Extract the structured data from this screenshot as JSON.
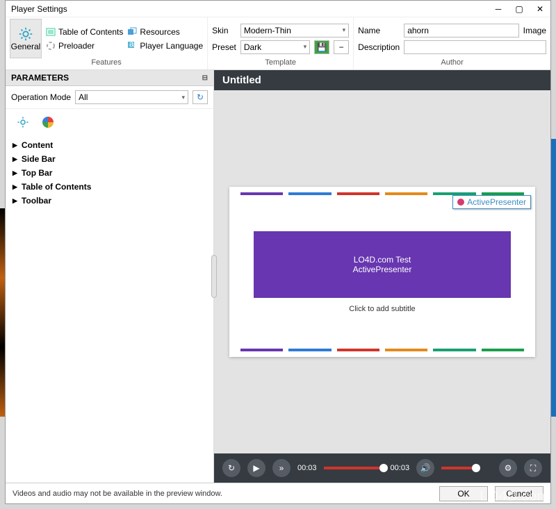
{
  "window": {
    "title": "Player Settings"
  },
  "ribbon": {
    "general": {
      "label": "General"
    },
    "features": {
      "label": "Features",
      "toc": "Table of Contents",
      "preloader": "Preloader",
      "resources": "Resources",
      "player_lang": "Player Language"
    },
    "template": {
      "label": "Template",
      "skin_label": "Skin",
      "skin_value": "Modern-Thin",
      "preset_label": "Preset",
      "preset_value": "Dark"
    },
    "author": {
      "label": "Author",
      "name_label": "Name",
      "name_value": "ahorn",
      "image_label": "Image",
      "desc_label": "Description",
      "desc_value": ""
    }
  },
  "params": {
    "header": "PARAMETERS",
    "op_mode_label": "Operation Mode",
    "op_mode_value": "All",
    "tree": {
      "content": "Content",
      "sidebar": "Side Bar",
      "topbar": "Top Bar",
      "toc": "Table of Contents",
      "toolbar": "Toolbar"
    }
  },
  "preview": {
    "title": "Untitled",
    "slide_line1": "LO4D.com Test",
    "slide_line2": "ActivePresenter",
    "subtitle": "Click to add subtitle",
    "ap_badge": "ActivePresenter",
    "colors": [
      "#6736b0",
      "#2f7bd4",
      "#d0342c",
      "#e38a1b",
      "#1a9f74",
      "#1a9f4a"
    ],
    "time_current": "00:03",
    "time_total": "00:03"
  },
  "footer": {
    "message": "Videos and audio may not be available in the preview window.",
    "ok": "OK",
    "cancel": "Cancel"
  },
  "watermark": "LO4D.com"
}
